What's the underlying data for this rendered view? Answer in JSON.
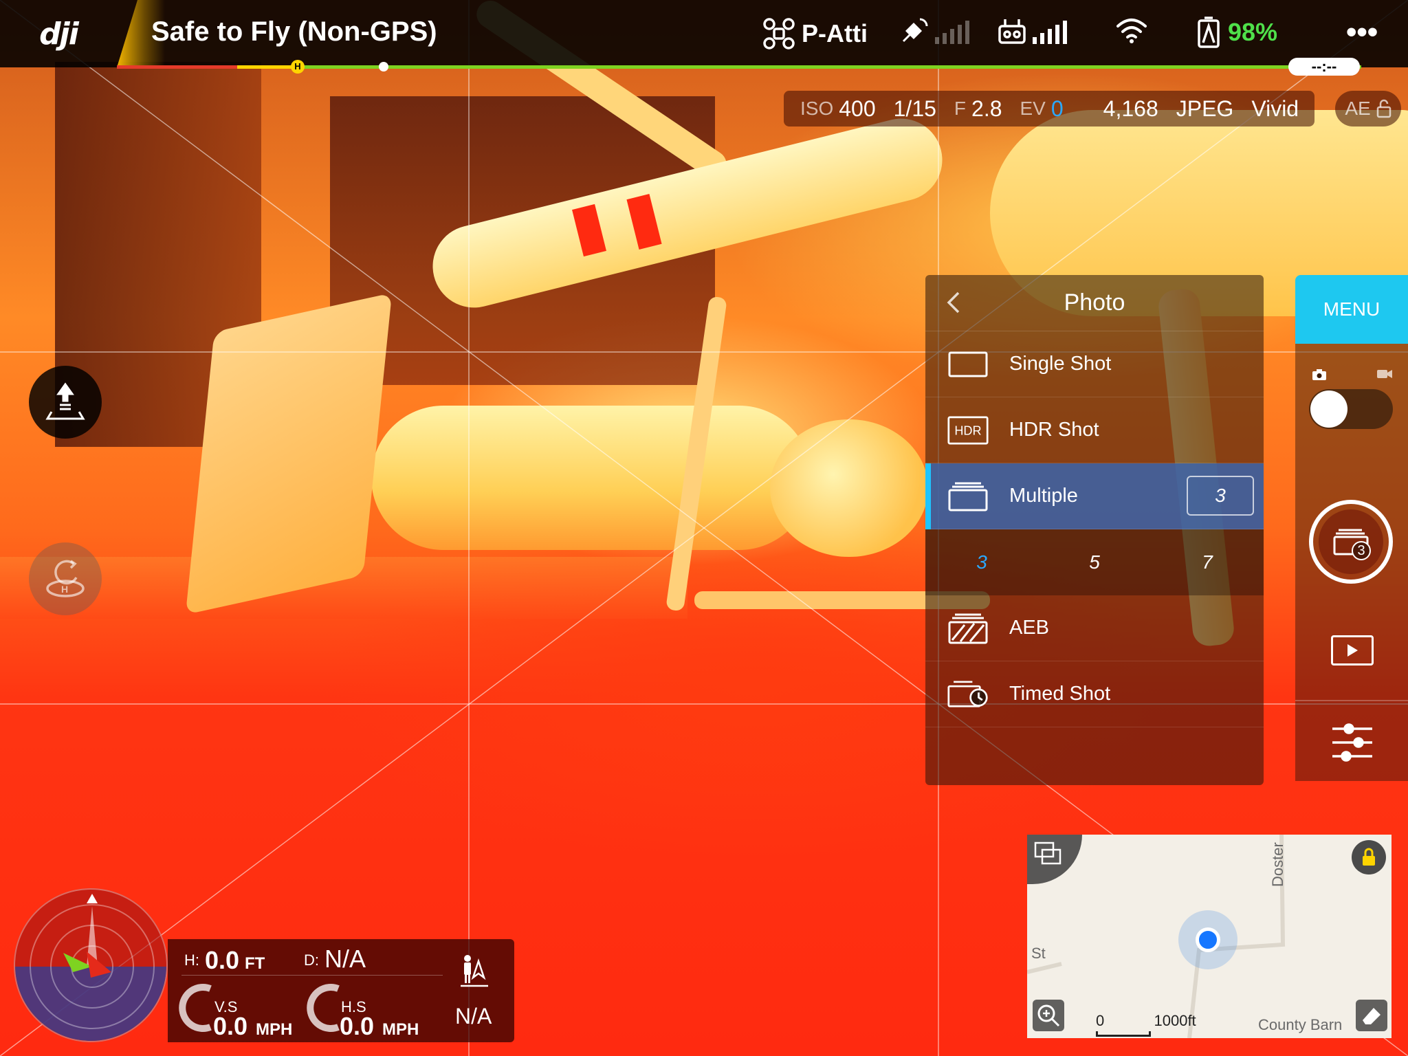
{
  "topbar": {
    "brand": "dji",
    "status": "Safe to Fly (Non-GPS)",
    "flight_mode": "P-Atti",
    "battery": "98%",
    "battery_color": "#4fe04a",
    "time_remaining": "--:--",
    "home_marker": "H",
    "icons": [
      "drone-icon",
      "satellite-icon",
      "remote-controller-icon",
      "wifi-icon",
      "battery-icon",
      "more-icon"
    ]
  },
  "camera_settings": {
    "iso_label": "ISO",
    "iso": "400",
    "shutter": "1/15",
    "aperture_label": "F",
    "aperture": "2.8",
    "ev_label": "EV",
    "ev": "0",
    "remaining_shots": "4,168",
    "format": "JPEG",
    "style": "Vivid",
    "ae_label": "AE"
  },
  "photo_panel": {
    "title": "Photo",
    "modes": [
      {
        "label": "Single Shot",
        "icon": "single-shot-icon"
      },
      {
        "label": "HDR Shot",
        "icon": "hdr-icon",
        "icon_text": "HDR"
      },
      {
        "label": "Multiple",
        "icon": "multiple-icon",
        "selected": true,
        "count": "3"
      },
      {
        "label": "AEB",
        "icon": "aeb-icon"
      },
      {
        "label": "Timed Shot",
        "icon": "timed-shot-icon"
      }
    ],
    "burst_options": [
      "3",
      "5",
      "7"
    ],
    "burst_selected": "3",
    "accent_color": "#1ec5ff"
  },
  "right_column": {
    "menu_label": "MENU",
    "menu_color": "#1ec8f0",
    "shutter_badge": "3"
  },
  "telemetry": {
    "h_label": "H:",
    "h_value": "0.0",
    "h_unit": "FT",
    "d_label": "D:",
    "d_value": "N/A",
    "vs_label": "V.S",
    "vs_value": "0.0",
    "vs_unit": "MPH",
    "hs_label": "H.S",
    "hs_value": "0.0",
    "hs_unit": "MPH",
    "pilot_distance": "N/A"
  },
  "map": {
    "street_top": "Doster",
    "street_left": "St",
    "street_bottom": "County Barn",
    "scale_start": "0",
    "scale_end": "1000ft"
  }
}
